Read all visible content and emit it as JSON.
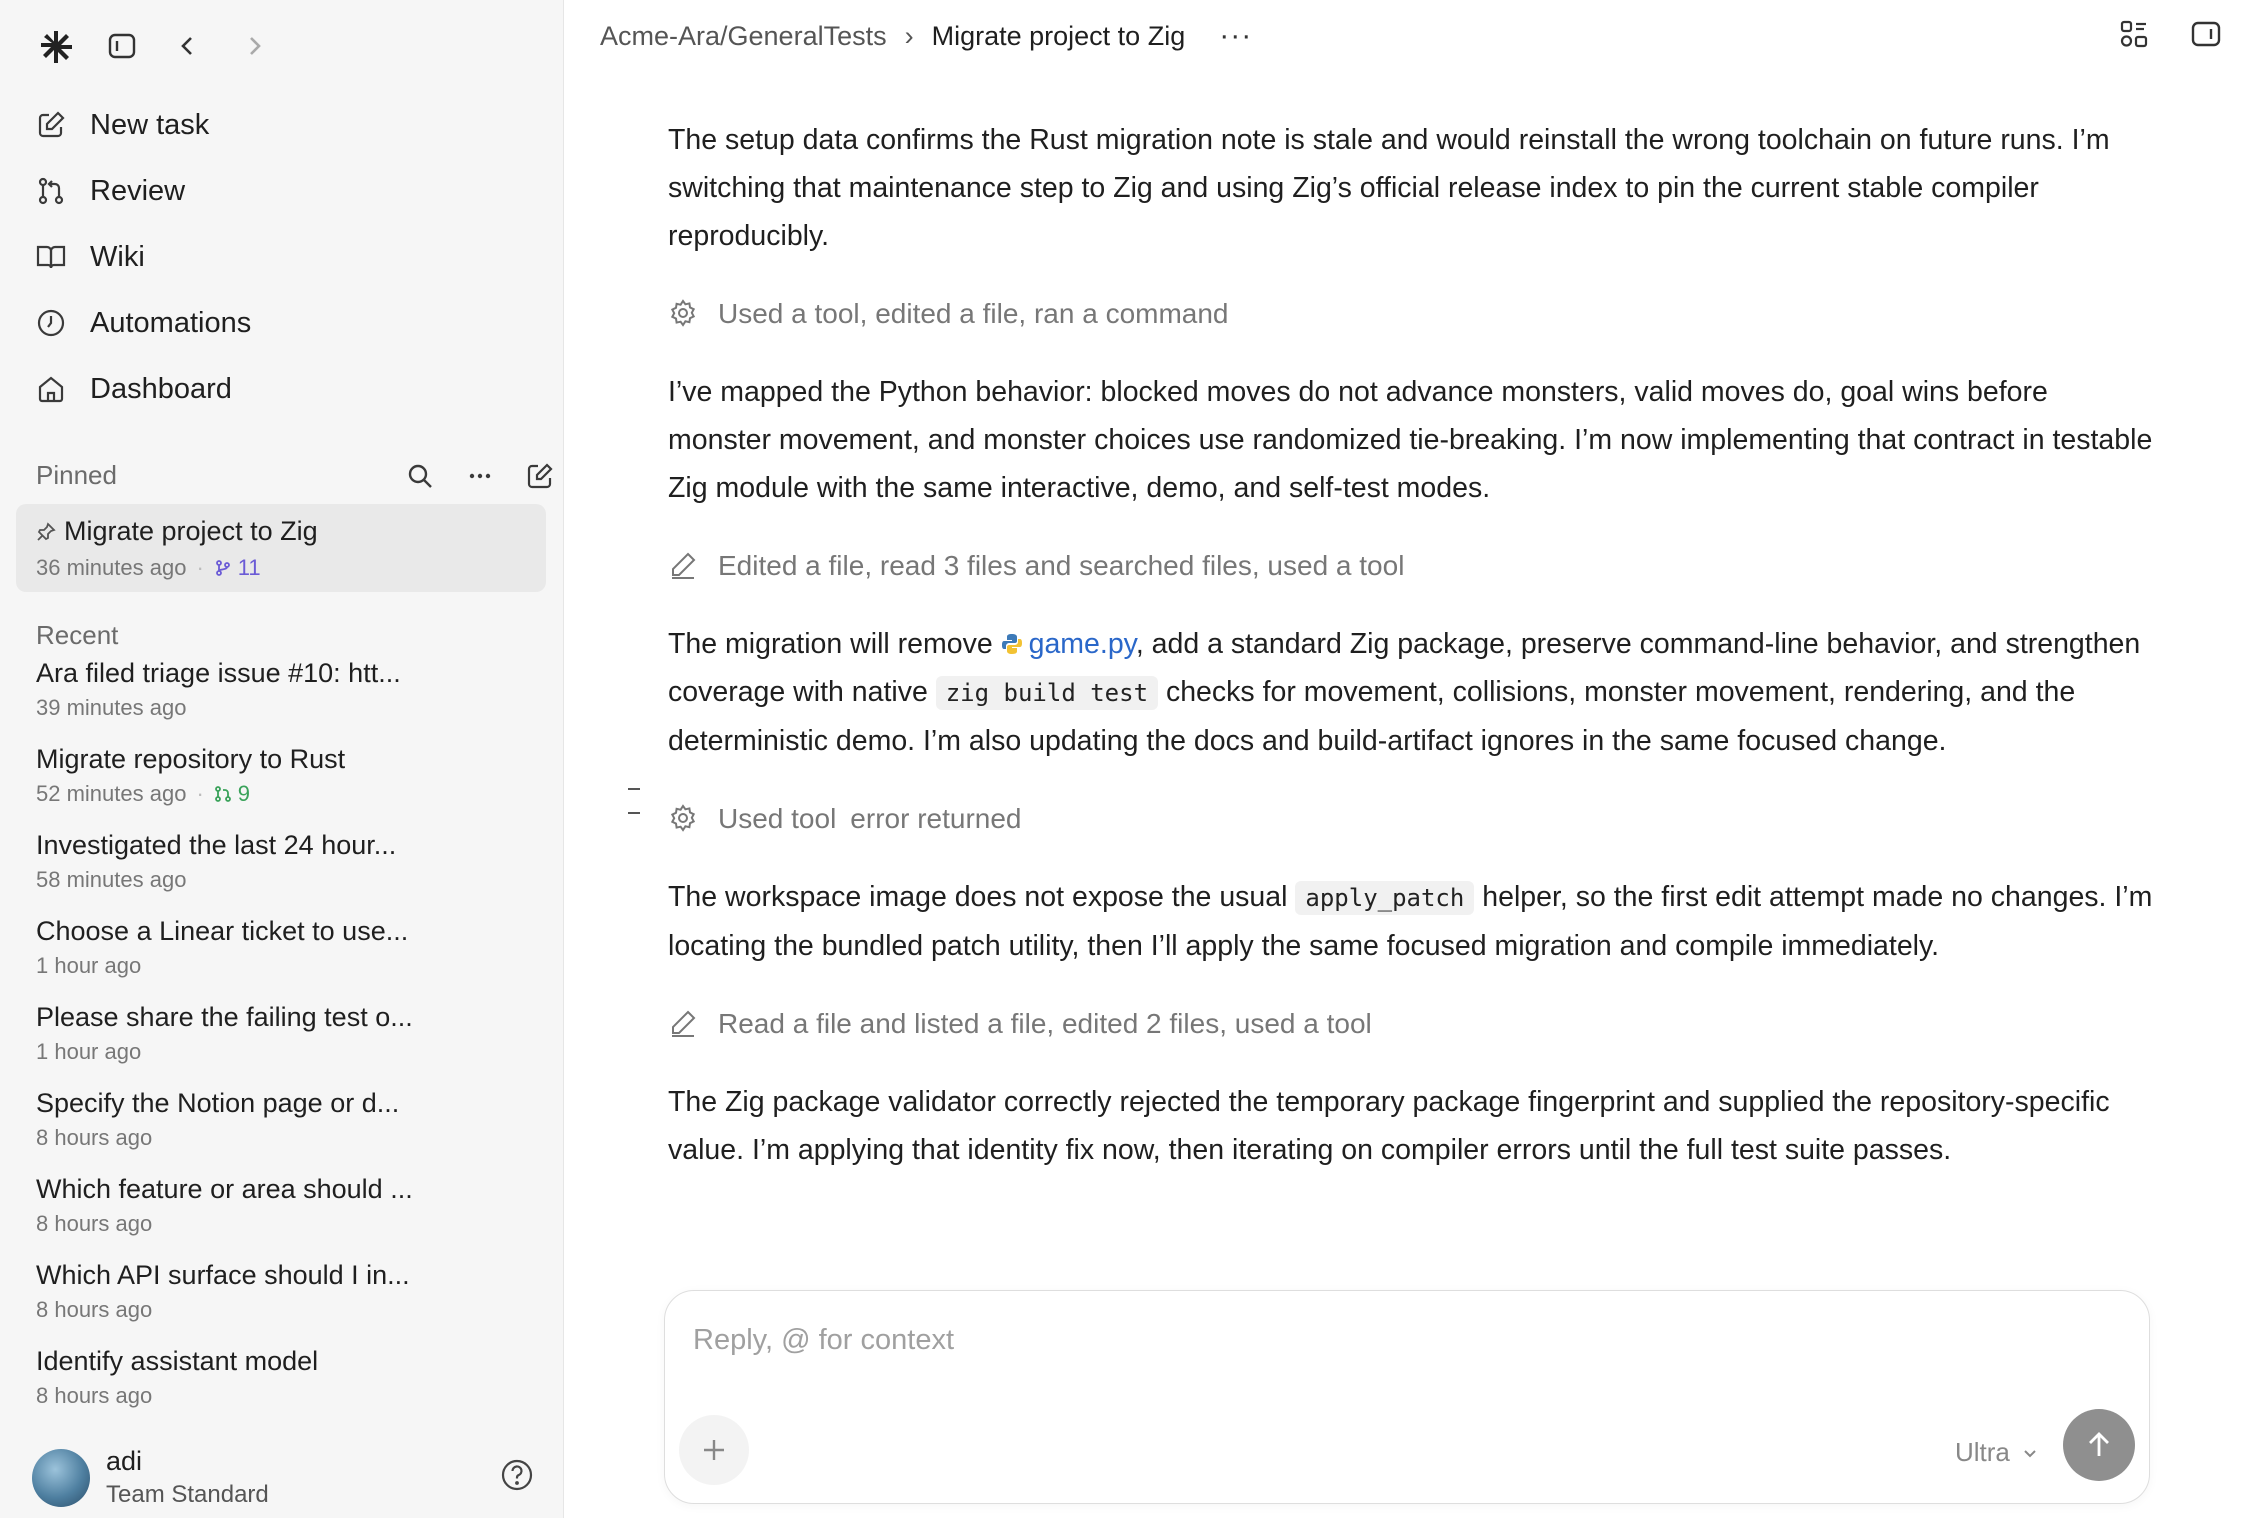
{
  "sidebar": {
    "nav": [
      {
        "label": "New task",
        "icon": "edit-icon"
      },
      {
        "label": "Review",
        "icon": "git-pull-request-icon"
      },
      {
        "label": "Wiki",
        "icon": "book-icon"
      },
      {
        "label": "Automations",
        "icon": "clock-icon"
      },
      {
        "label": "Dashboard",
        "icon": "home-icon"
      }
    ],
    "pinned_label": "Pinned",
    "pinned_item": {
      "title": "Migrate project to Zig",
      "time": "36 minutes ago",
      "branch_count": "11"
    },
    "recent_label": "Recent",
    "recent": [
      {
        "title": "Ara filed triage issue #10: htt...",
        "time": "39 minutes ago"
      },
      {
        "title": "Migrate repository to Rust",
        "time": "52 minutes ago",
        "pr_count": "9"
      },
      {
        "title": "Investigated the last 24 hour...",
        "time": "58 minutes ago"
      },
      {
        "title": "Choose a Linear ticket to use...",
        "time": "1 hour ago"
      },
      {
        "title": "Please share the failing test o...",
        "time": "1 hour ago"
      },
      {
        "title": "Specify the Notion page or d...",
        "time": "8 hours ago"
      },
      {
        "title": "Which feature or area should ...",
        "time": "8 hours ago"
      },
      {
        "title": "Which API surface should I in...",
        "time": "8 hours ago"
      },
      {
        "title": "Identify assistant model",
        "time": "8 hours ago"
      }
    ],
    "user": {
      "name": "adi",
      "plan": "Team Standard"
    }
  },
  "header": {
    "repo": "Acme-Ara/GeneralTests",
    "separator": "›",
    "title": "Migrate project to Zig",
    "more": "···"
  },
  "transcript": {
    "p1": "The setup data confirms the Rust migration note is stale and would reinstall the wrong toolchain on future runs. I’m switching that maintenance step to Zig and using Zig’s official release index to pin the current stable compiler reproducibly.",
    "tool1": "Used a tool, edited a file, ran a command",
    "p2": "I’ve mapped the Python behavior: blocked moves do not advance monsters, valid moves do, goal wins before monster movement, and monster choices use randomized tie-breaking. I’m now implementing that contract in testable Zig module with the same interactive, demo, and self-test modes.",
    "tool2": "Edited a file, read 3 files and searched files, used a tool",
    "p3_a": "The migration will remove ",
    "p3_file": "game.py",
    "p3_b": ", add a standard Zig package, preserve command-line behavior, and strengthen coverage with native ",
    "p3_code": "zig build test",
    "p3_c": " checks for movement, collisions, monster movement, rendering, and the deterministic demo. I’m also updating the docs and build-artifact ignores in the same focused change.",
    "tool3_a": "Used tool",
    "tool3_b": "error returned",
    "p4_a": "The workspace image does not expose the usual ",
    "p4_code": "apply_patch",
    "p4_b": " helper, so the first edit attempt made no changes. I’m locating the bundled patch utility, then I’ll apply the same focused migration and compile immediately.",
    "tool4": "Read a file and listed a file, edited 2 files, used a tool",
    "p5": "The Zig package validator correctly rejected the temporary package fingerprint and supplied the repository-specific value. I’m applying that identity fix now, then iterating on compiler errors until the full test suite passes."
  },
  "composer": {
    "placeholder": "Reply, @ for context",
    "value": "",
    "model": "Ultra"
  }
}
